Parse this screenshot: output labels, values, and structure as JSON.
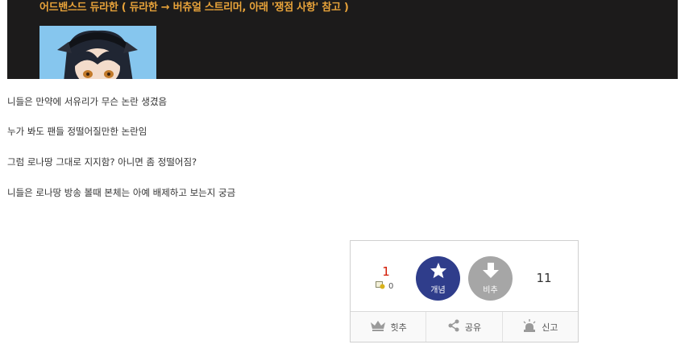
{
  "banner": {
    "caption": "어드밴스드 듀라한 ( 듀라한 → 버츄얼 스트리머, 아래 '쟁점 사항' 참고 )"
  },
  "post": {
    "lines": [
      "니들은 만약에 서유리가 무슨 논란 생겼음",
      "누가 봐도 팬들 정떨어질만한 논란임",
      "그럼 로나땅 그대로 지지함? 아니면 좀 정떨어짐?",
      "니들은 로나땅 방송 볼때 본체는 아예 배제하고 보는지 궁금"
    ]
  },
  "vote": {
    "up_count": "1",
    "fixed_count": "0",
    "up_label": "개념",
    "down_label": "비추",
    "down_count": "11"
  },
  "actions": {
    "hit_label": "힛추",
    "share_label": "공유",
    "report_label": "신고"
  },
  "colors": {
    "banner_bg": "#1c1b1b",
    "banner_text": "#e8a33a",
    "up_button": "#2f3d8b",
    "down_button": "#a6a6a6",
    "up_count": "#d31900"
  },
  "icons": [
    "star-icon",
    "arrow-down-icon",
    "crown-icon",
    "share-icon",
    "siren-icon",
    "fixed-reco-icon"
  ]
}
